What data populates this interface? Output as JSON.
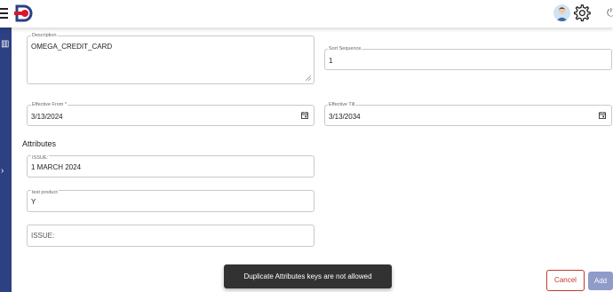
{
  "header": {
    "menu_icon": "hamburger-icon",
    "logo_icon": "brand-logo-icon",
    "avatar_icon": "user-avatar-icon",
    "settings_icon": "gear-icon",
    "power_icon": "power-icon"
  },
  "form": {
    "description": {
      "label": "Description",
      "value": "OMEGA_CREDIT_CARD"
    },
    "sort_sequence": {
      "label": "Sort Sequence",
      "value": "1"
    },
    "effective_from": {
      "label": "Effective From *",
      "value": "3/13/2024"
    },
    "effective_till": {
      "label": "Effective Till",
      "value": "3/13/2034"
    }
  },
  "attributes": {
    "title": "Attributes",
    "items": [
      {
        "label": "ISSUE:",
        "value": "1 MARCH 2024"
      },
      {
        "label": "test product",
        "value": "Y"
      },
      {
        "label": "",
        "value": "",
        "placeholder": "ISSUE:"
      }
    ]
  },
  "toast": {
    "message": "Duplicate Attributes keys are not allowed"
  },
  "actions": {
    "cancel_label": "Cancel",
    "add_label": "Add"
  },
  "colors": {
    "sidebar": "#2c4082",
    "brand_red": "#e0142c",
    "cancel": "#c0392b",
    "add": "#8f9bc9"
  }
}
